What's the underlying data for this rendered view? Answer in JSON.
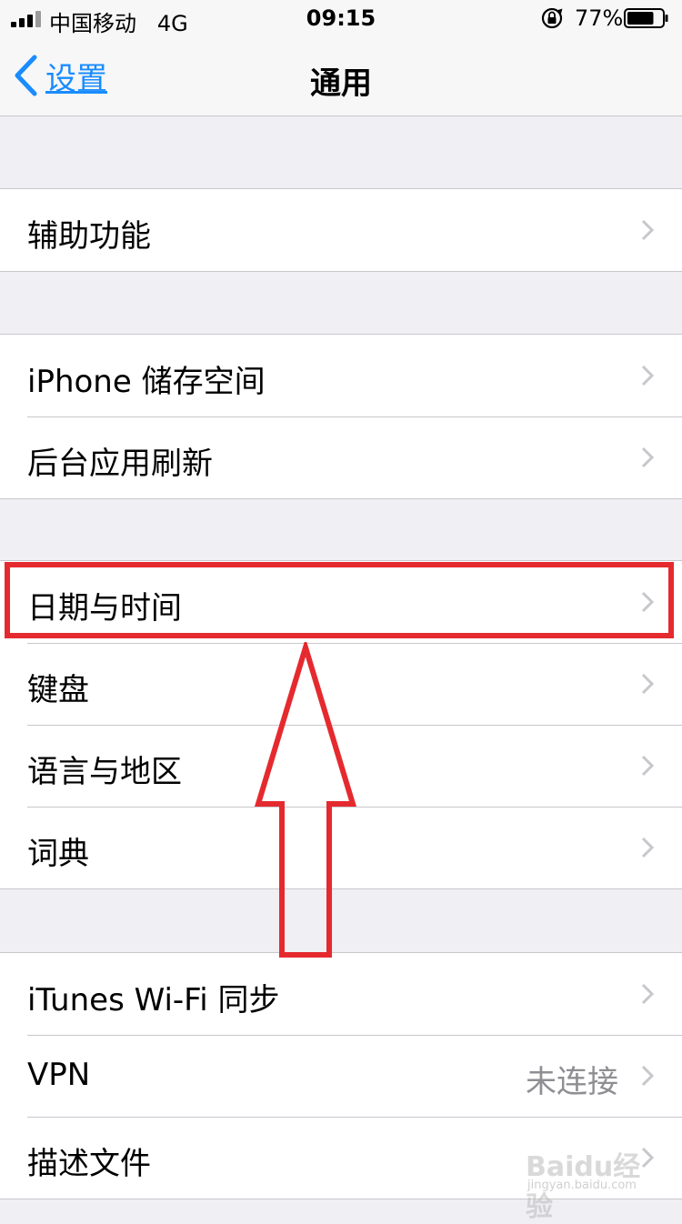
{
  "status_bar": {
    "carrier": "中国移动",
    "network": "4G",
    "time": "09:15",
    "battery_percent": "77%",
    "battery_level": 0.77,
    "icons": [
      "signal-icon",
      "orientation-lock-icon",
      "battery-icon"
    ]
  },
  "nav": {
    "back_label": "设置",
    "title": "通用"
  },
  "groups": [
    {
      "rows": [
        {
          "label": "辅助功能"
        }
      ]
    },
    {
      "rows": [
        {
          "label": "iPhone 储存空间"
        },
        {
          "label": "后台应用刷新"
        }
      ]
    },
    {
      "rows": [
        {
          "label": "日期与时间"
        },
        {
          "label": "键盘"
        },
        {
          "label": "语言与地区"
        },
        {
          "label": "词典"
        }
      ]
    },
    {
      "rows": [
        {
          "label": "iTunes Wi-Fi 同步"
        },
        {
          "label": "VPN",
          "detail": "未连接"
        },
        {
          "label": "描述文件"
        }
      ]
    }
  ],
  "colors": {
    "accent": "#1a8cff",
    "annotation": "#e52a2f",
    "background": "#efeff4",
    "separator": "#c8c7cc",
    "detail_text": "#8e8e93"
  },
  "watermark": {
    "brand": "Baidu经验",
    "url": "jingyan.baidu.com"
  }
}
